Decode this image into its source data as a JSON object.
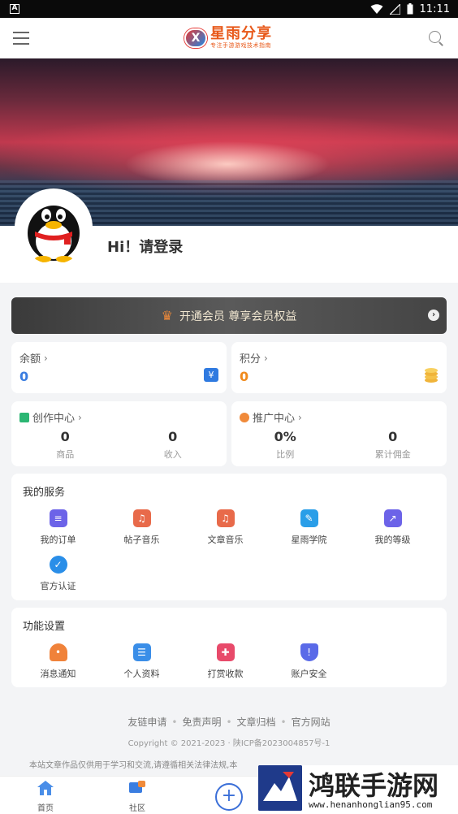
{
  "status_bar": {
    "time": "11:11"
  },
  "header": {
    "logo_badge": "X",
    "logo_title": "星雨分享",
    "logo_subtitle": "专注手游游戏技术指南"
  },
  "profile": {
    "login_text": "Hi！请登录"
  },
  "vip": {
    "label": "开通会员 尊享会员权益"
  },
  "balance": {
    "label": "余额",
    "value": "0",
    "icon_glyph": "¥"
  },
  "points": {
    "label": "积分",
    "value": "0"
  },
  "creation": {
    "label": "创作中心",
    "stats": [
      {
        "value": "0",
        "label": "商品"
      },
      {
        "value": "0",
        "label": "收入"
      }
    ]
  },
  "promotion": {
    "label": "推广中心",
    "stats": [
      {
        "value": "0%",
        "label": "比例"
      },
      {
        "value": "0",
        "label": "累计佣金"
      }
    ]
  },
  "services": {
    "title": "我的服务",
    "items": [
      {
        "label": "我的订单",
        "icon": "order-icon",
        "color": "#6c63e8"
      },
      {
        "label": "帖子音乐",
        "icon": "music-icon",
        "color": "#e86a4a"
      },
      {
        "label": "文章音乐",
        "icon": "music-icon",
        "color": "#e86a4a"
      },
      {
        "label": "星雨学院",
        "icon": "academy-icon",
        "color": "#2a9ee8"
      },
      {
        "label": "我的等级",
        "icon": "level-icon",
        "color": "#6c63e8"
      },
      {
        "label": "官方认证",
        "icon": "verified-icon",
        "color": "#2a8ee8"
      }
    ]
  },
  "settings": {
    "title": "功能设置",
    "items": [
      {
        "label": "消息通知",
        "icon": "bell-icon",
        "color": "#f0823a"
      },
      {
        "label": "个人资料",
        "icon": "profile-icon",
        "color": "#3a8ee8"
      },
      {
        "label": "打赏收款",
        "icon": "gift-icon",
        "color": "#e84a6a"
      },
      {
        "label": "账户安全",
        "icon": "shield-icon",
        "color": "#5a6ae8"
      }
    ]
  },
  "footer": {
    "links": [
      "友链申请",
      "免责声明",
      "文章归档",
      "官方网站"
    ],
    "copyright": "Copyright © 2021-2023 · 陕ICP备2023004857号-1",
    "disclaimer": "本站文章作品仅供用于学习和交流,请遵循相关法律法规,本"
  },
  "tabbar": {
    "home": "首页",
    "community": "社区"
  },
  "watermark": {
    "title": "鸿联手游网",
    "url": "www.henanhonglian95.com"
  }
}
